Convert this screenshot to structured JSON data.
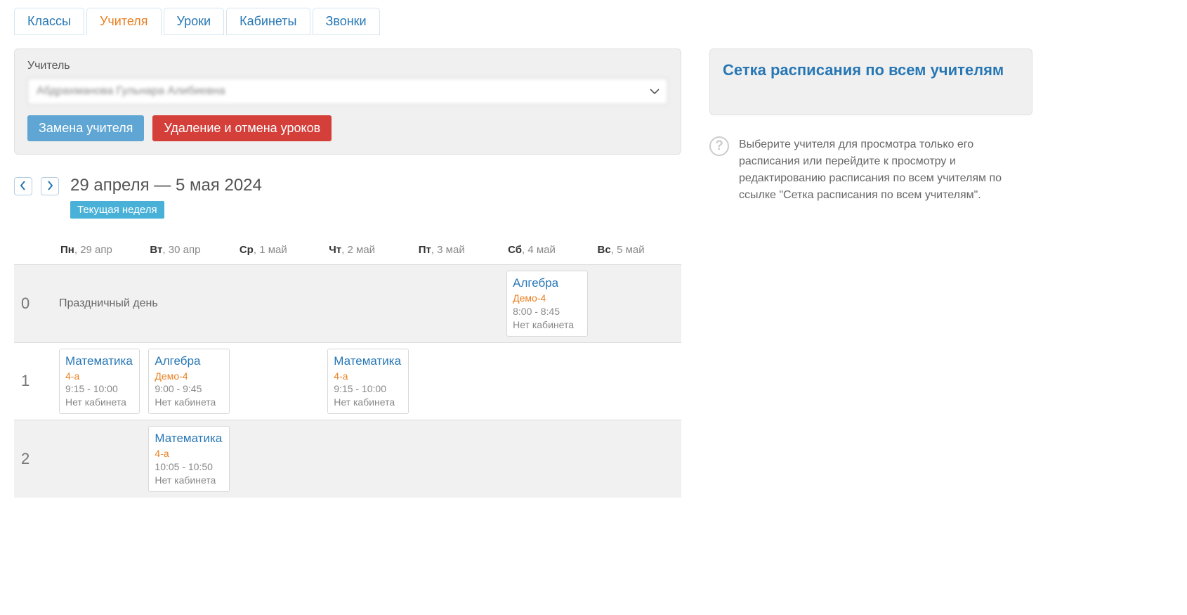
{
  "tabs": [
    {
      "id": "classes",
      "label": "Классы",
      "active": false
    },
    {
      "id": "teachers",
      "label": "Учителя",
      "active": true
    },
    {
      "id": "lessons",
      "label": "Уроки",
      "active": false
    },
    {
      "id": "rooms",
      "label": "Кабинеты",
      "active": false
    },
    {
      "id": "bells",
      "label": "Звонки",
      "active": false
    }
  ],
  "panel": {
    "label": "Учитель",
    "teacher_select_value": "Абдрахманова Гульнара Алибиевна",
    "replace_btn": "Замена учителя",
    "delete_btn": "Удаление и отмена уроков"
  },
  "side": {
    "grid_link": "Сетка расписания по всем учителям",
    "help_text": "Выберите учителя для просмотра только его расписания или перейдите к просмотру и редактированию расписания по всем учителям по ссылке \"Сетка расписания по всем учителям\"."
  },
  "date_nav": {
    "range": "29 апреля — 5 мая 2024",
    "badge": "Текущая неделя"
  },
  "days": [
    {
      "abbr": "Пн",
      "date": "29 апр"
    },
    {
      "abbr": "Вт",
      "date": "30 апр"
    },
    {
      "abbr": "Ср",
      "date": "1 май"
    },
    {
      "abbr": "Чт",
      "date": "2 май"
    },
    {
      "abbr": "Пт",
      "date": "3 май"
    },
    {
      "abbr": "Сб",
      "date": "4 май"
    },
    {
      "abbr": "Вс",
      "date": "5 май"
    }
  ],
  "rows": [
    "0",
    "1",
    "2"
  ],
  "holiday_text": "Праздничный день",
  "lessons": {
    "r0_sat": {
      "subject": "Алгебра",
      "class": "Демо-4",
      "time": "8:00 - 8:45",
      "room": "Нет кабинета"
    },
    "r1_mon": {
      "subject": "Математика",
      "class": "4-а",
      "time": "9:15 - 10:00",
      "room": "Нет кабинета"
    },
    "r1_tue": {
      "subject": "Алгебра",
      "class": "Демо-4",
      "time": "9:00 - 9:45",
      "room": "Нет кабинета"
    },
    "r1_thu": {
      "subject": "Математика",
      "class": "4-а",
      "time": "9:15 - 10:00",
      "room": "Нет кабинета"
    },
    "r2_tue": {
      "subject": "Математика",
      "class": "4-а",
      "time": "10:05 - 10:50",
      "room": "Нет кабинета"
    }
  }
}
